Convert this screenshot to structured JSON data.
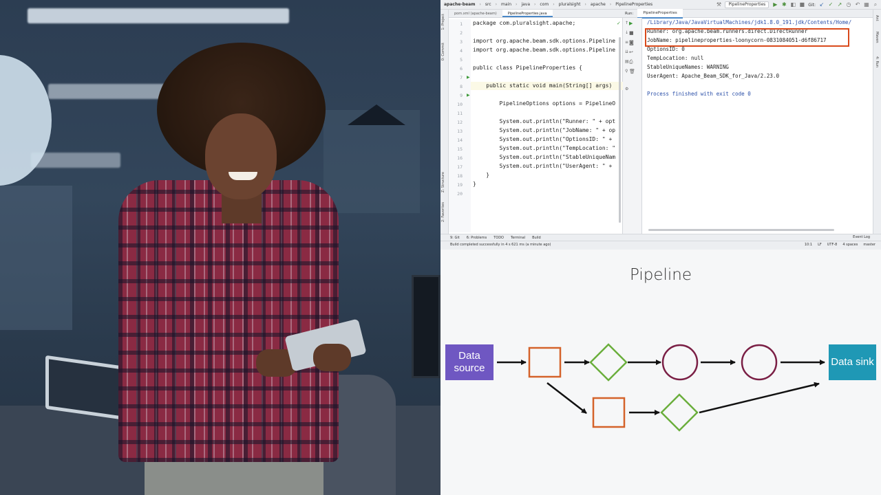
{
  "ide": {
    "breadcrumb": [
      "apache-beam",
      "src",
      "main",
      "java",
      "com",
      "pluralsight",
      "apache",
      "PipelineProperties"
    ],
    "run_config": "PipelineProperties",
    "git_label": "Git:",
    "left_tabs": [
      "1: Project",
      "0: Commit",
      "Z: Structure",
      "2: Favorites"
    ],
    "right_tabs": [
      "Ant",
      "Maven",
      "4: Run"
    ],
    "editor_tabs": [
      "pom.xml (apache-beam)",
      "PipelineProperties.java"
    ],
    "line_numbers": [
      "1",
      "2",
      "3",
      "4",
      "5",
      "6",
      "7",
      "8",
      "9",
      "10",
      "11",
      "12",
      "13",
      "14",
      "15",
      "16",
      "17",
      "18",
      "19",
      "20"
    ],
    "code_lines": [
      "package com.pluralsight.apache;",
      "",
      "import org.apache.beam.sdk.options.Pipeline",
      "import org.apache.beam.sdk.options.Pipeline",
      "",
      "public class PipelineProperties {",
      "",
      "    public static void main(String[] args)",
      "",
      "        PipelineOptions options = PipelineO",
      "",
      "        System.out.println(\"Runner: \" + opt",
      "        System.out.println(\"JobName: \" + op",
      "        System.out.println(\"OptionsID: \" + ",
      "        System.out.println(\"TempLocation: \"",
      "        System.out.println(\"StableUniqueNam",
      "        System.out.println(\"UserAgent: \" + ",
      "    }",
      "}",
      ""
    ],
    "run_label": "Run:",
    "run_tab": "PipelineProperties",
    "console_lines": [
      "/Library/Java/JavaVirtualMachines/jdk1.8.0_191.jdk/Contents/Home/",
      "Runner: org.apache.beam.runners.direct.DirectRunner",
      "JobName: pipelineproperties-loonycorn-0831084051-d6f86717",
      "OptionsID: 0",
      "TempLocation: null",
      "StableUniqueNames: WARNING",
      "UserAgent: Apache_Beam_SDK_for_Java/2.23.0",
      "",
      "Process finished with exit code 0"
    ],
    "bottom_tabs": [
      "9: Git",
      "6: Problems",
      "TODO",
      "Terminal",
      "Build"
    ],
    "event_log": "Event Log",
    "status_message": "Build completed successfully in 4 s 621 ms (a minute ago)",
    "status_right": [
      "10:1",
      "LF",
      "UTF-8",
      "4 spaces",
      "master"
    ]
  },
  "diagram": {
    "title": "Pipeline",
    "source_label": "Data source",
    "sink_label": "Data sink",
    "colors": {
      "source": "#6f57c2",
      "sink": "#1f98b5",
      "square": "#d4622a",
      "diamond": "#6aae3c",
      "circle": "#7a1f45",
      "arrow": "#111111"
    }
  }
}
